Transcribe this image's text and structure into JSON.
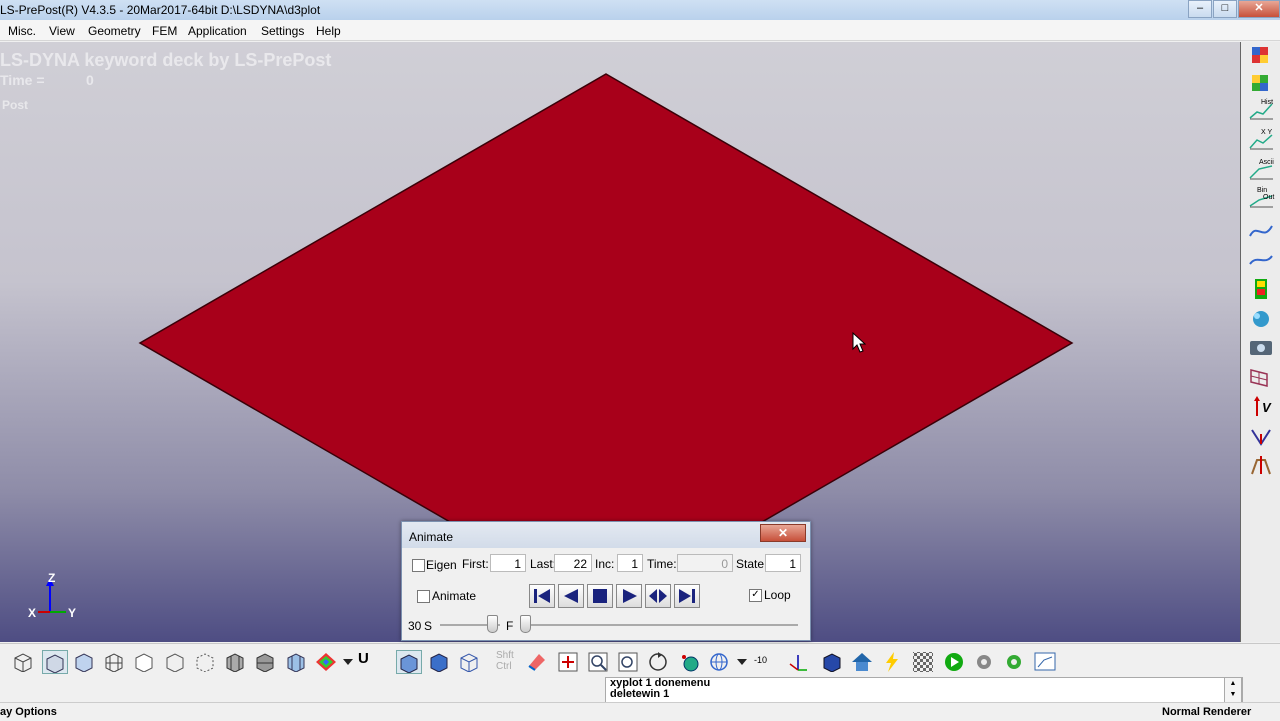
{
  "window": {
    "title": "LS-PrePost(R) V4.3.5 - 20Mar2017-64bit D:\\LSDYNA\\d3plot"
  },
  "menu": [
    "Misc.",
    "View",
    "Geometry",
    "FEM",
    "Application",
    "Settings",
    "Help"
  ],
  "viewport": {
    "header": "LS-DYNA keyword deck by LS-PrePost",
    "time_label": "Time =",
    "time_value": "0",
    "post_label": "Post",
    "axes": {
      "z": "Z",
      "x": "X",
      "y": "Y"
    },
    "shell_color": "#a8001a"
  },
  "animate": {
    "title": "Animate",
    "close": "✕",
    "eigen_label": "Eigen",
    "first_label": "First:",
    "first_value": "1",
    "last_label": "Last:",
    "last_value": "22",
    "inc_label": "Inc:",
    "inc_value": "1",
    "time_label": "Time:",
    "time_value": "0",
    "state_label": "State:",
    "state_value": "1",
    "animate_label": "Animate",
    "loop_label": "Loop",
    "loop_checked": "✓",
    "speed_value": "30",
    "speed_unit": "S",
    "frame_label": "F"
  },
  "bottom_toolbar": {
    "u_label": "U",
    "shft_label": "Shft",
    "ctrl_label": "Ctrl",
    "angle_label": "-10"
  },
  "console": {
    "lines": [
      "xyplot 1 donemenu",
      "deletewin 1"
    ]
  },
  "status": {
    "left": "ay Options",
    "right": "Normal Renderer"
  },
  "right_toolbar": {
    "hist": "Hist",
    "xy": "X Y",
    "ascii": "Ascii",
    "bin": "Bin",
    "out": "Out",
    "v": "V"
  }
}
